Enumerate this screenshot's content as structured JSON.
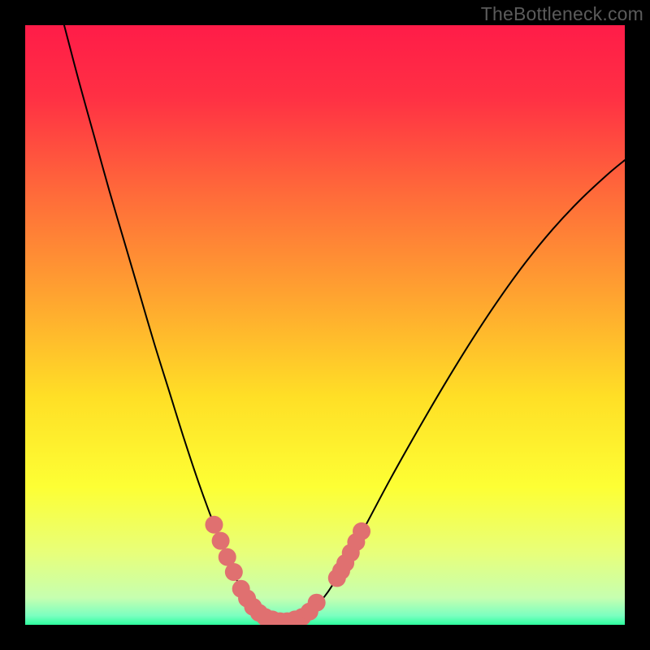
{
  "watermark": "TheBottleneck.com",
  "chart_data": {
    "type": "line",
    "title": "",
    "xlabel": "",
    "ylabel": "",
    "xlim": [
      0,
      1
    ],
    "ylim": [
      0,
      1
    ],
    "background": {
      "type": "vertical-gradient",
      "stops": [
        {
          "offset": 0.0,
          "color": "#ff1c48"
        },
        {
          "offset": 0.12,
          "color": "#ff3044"
        },
        {
          "offset": 0.28,
          "color": "#ff6a3a"
        },
        {
          "offset": 0.45,
          "color": "#ffa330"
        },
        {
          "offset": 0.62,
          "color": "#ffdf26"
        },
        {
          "offset": 0.77,
          "color": "#fdff34"
        },
        {
          "offset": 0.88,
          "color": "#e8ff7a"
        },
        {
          "offset": 0.955,
          "color": "#c6ffb0"
        },
        {
          "offset": 0.985,
          "color": "#7affc0"
        },
        {
          "offset": 1.0,
          "color": "#2dff9e"
        }
      ]
    },
    "series": [
      {
        "name": "bottleneck-curve",
        "color": "#000000",
        "width": 2,
        "points": [
          {
            "x": 0.065,
            "y": 1.0
          },
          {
            "x": 0.09,
            "y": 0.905
          },
          {
            "x": 0.115,
            "y": 0.815
          },
          {
            "x": 0.14,
            "y": 0.725
          },
          {
            "x": 0.165,
            "y": 0.64
          },
          {
            "x": 0.19,
            "y": 0.555
          },
          {
            "x": 0.215,
            "y": 0.47
          },
          {
            "x": 0.24,
            "y": 0.39
          },
          {
            "x": 0.265,
            "y": 0.31
          },
          {
            "x": 0.29,
            "y": 0.235
          },
          {
            "x": 0.315,
            "y": 0.167
          },
          {
            "x": 0.34,
            "y": 0.105
          },
          {
            "x": 0.36,
            "y": 0.06
          },
          {
            "x": 0.38,
            "y": 0.03
          },
          {
            "x": 0.4,
            "y": 0.013
          },
          {
            "x": 0.42,
            "y": 0.006
          },
          {
            "x": 0.44,
            "y": 0.006
          },
          {
            "x": 0.46,
            "y": 0.012
          },
          {
            "x": 0.48,
            "y": 0.027
          },
          {
            "x": 0.505,
            "y": 0.055
          },
          {
            "x": 0.535,
            "y": 0.105
          },
          {
            "x": 0.57,
            "y": 0.17
          },
          {
            "x": 0.61,
            "y": 0.245
          },
          {
            "x": 0.655,
            "y": 0.325
          },
          {
            "x": 0.7,
            "y": 0.402
          },
          {
            "x": 0.745,
            "y": 0.475
          },
          {
            "x": 0.79,
            "y": 0.543
          },
          {
            "x": 0.835,
            "y": 0.605
          },
          {
            "x": 0.88,
            "y": 0.66
          },
          {
            "x": 0.925,
            "y": 0.708
          },
          {
            "x": 0.97,
            "y": 0.75
          },
          {
            "x": 1.0,
            "y": 0.775
          }
        ]
      },
      {
        "name": "highlight-left",
        "color": "#e07070",
        "type": "scatter",
        "points": [
          {
            "x": 0.315,
            "y": 0.167
          },
          {
            "x": 0.326,
            "y": 0.14
          },
          {
            "x": 0.337,
            "y": 0.113
          },
          {
            "x": 0.348,
            "y": 0.088
          },
          {
            "x": 0.36,
            "y": 0.06
          },
          {
            "x": 0.37,
            "y": 0.044
          },
          {
            "x": 0.38,
            "y": 0.03
          },
          {
            "x": 0.39,
            "y": 0.02
          },
          {
            "x": 0.4,
            "y": 0.013
          },
          {
            "x": 0.412,
            "y": 0.009
          },
          {
            "x": 0.425,
            "y": 0.006
          },
          {
            "x": 0.437,
            "y": 0.006
          },
          {
            "x": 0.45,
            "y": 0.009
          },
          {
            "x": 0.462,
            "y": 0.013
          },
          {
            "x": 0.474,
            "y": 0.022
          },
          {
            "x": 0.486,
            "y": 0.037
          }
        ]
      },
      {
        "name": "highlight-right",
        "color": "#e07070",
        "type": "scatter",
        "points": [
          {
            "x": 0.52,
            "y": 0.078
          },
          {
            "x": 0.527,
            "y": 0.09
          },
          {
            "x": 0.534,
            "y": 0.103
          },
          {
            "x": 0.543,
            "y": 0.12
          },
          {
            "x": 0.552,
            "y": 0.138
          },
          {
            "x": 0.561,
            "y": 0.156
          }
        ]
      }
    ]
  }
}
